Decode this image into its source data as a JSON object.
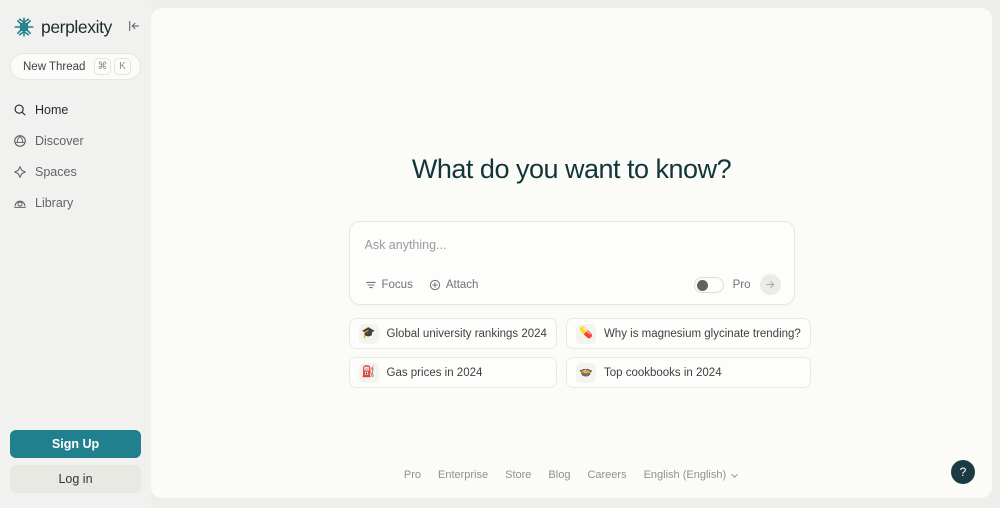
{
  "sidebar": {
    "logo_text": "perplexity",
    "collapse_label": "|←",
    "new_thread": {
      "label": "New Thread",
      "shortcut_mod": "⌘",
      "shortcut_key": "K"
    },
    "items": [
      {
        "label": "Home",
        "icon": "home-search-icon",
        "active": true
      },
      {
        "label": "Discover",
        "icon": "discover-globe-icon",
        "active": false
      },
      {
        "label": "Spaces",
        "icon": "spaces-diamond-icon",
        "active": false
      },
      {
        "label": "Library",
        "icon": "library-icon",
        "active": false
      }
    ],
    "sign_up_label": "Sign Up",
    "log_in_label": "Log in"
  },
  "main": {
    "title": "What do you want to know?",
    "composer": {
      "placeholder": "Ask anything...",
      "value": "",
      "focus_label": "Focus",
      "attach_label": "Attach",
      "pro_label": "Pro",
      "pro_enabled": false,
      "submit_label": "→"
    },
    "suggestions": [
      {
        "emoji": "🎓",
        "label": "Global university rankings 2024"
      },
      {
        "emoji": "💊",
        "label": "Why is magnesium glycinate trending?"
      },
      {
        "emoji": "⛽",
        "label": "Gas prices in 2024"
      },
      {
        "emoji": "🍲",
        "label": "Top cookbooks in 2024"
      }
    ],
    "footer": {
      "links": [
        "Pro",
        "Enterprise",
        "Store",
        "Blog",
        "Careers"
      ],
      "language": "English (English)"
    },
    "help_label": "?"
  },
  "colors": {
    "brand_teal": "#20808d",
    "sidebar_bg": "#f1f1ef",
    "main_bg": "#fbfbf7",
    "title_text": "#13343b",
    "help_bg": "#1b3a43"
  }
}
